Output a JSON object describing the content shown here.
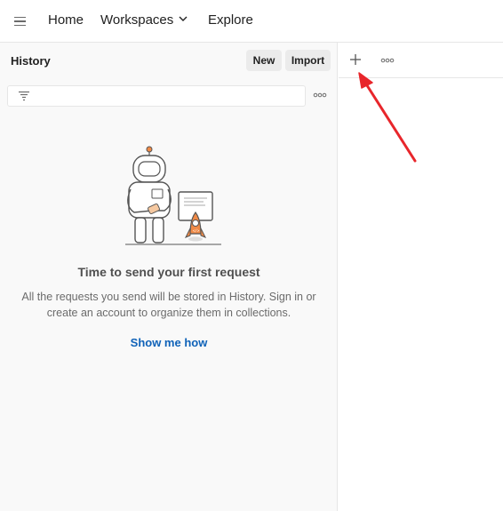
{
  "nav": {
    "menu_icon": "hamburger-icon",
    "home": "Home",
    "workspaces": "Workspaces",
    "explore": "Explore"
  },
  "history_panel": {
    "title": "History",
    "new_label": "New",
    "import_label": "Import",
    "filter_icon": "filter-icon",
    "more_icon": "more-horizontal-icon",
    "empty_state": {
      "illustration": "astronaut-with-rocket-illustration",
      "title": "Time to send your first request",
      "description": "All the requests you send will be stored in History. Sign in or create an account to organize them in collections.",
      "link": "Show me how"
    }
  },
  "tabs_bar": {
    "new_tab_icon": "plus-icon",
    "more_icon": "more-horizontal-icon"
  },
  "colors": {
    "link": "#0f62b8",
    "annotation_arrow": "#e8262b",
    "illustration_accent": "#f08a46"
  }
}
